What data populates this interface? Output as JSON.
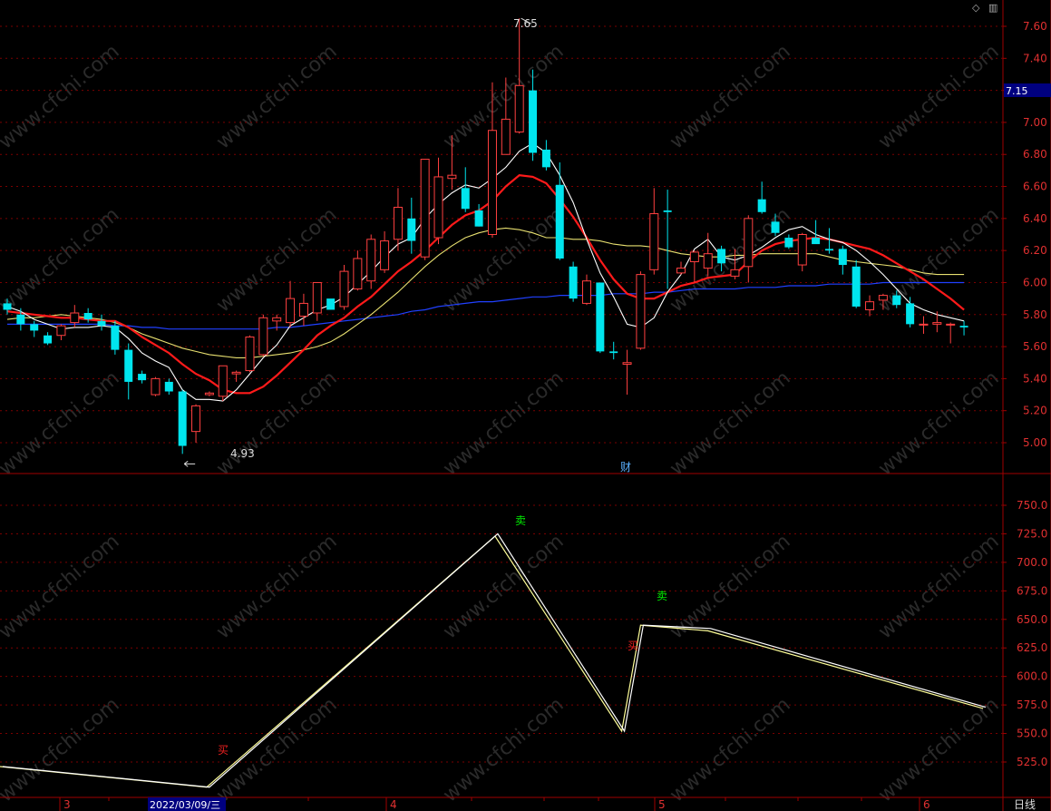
{
  "colors": {
    "up": "#ff4040",
    "down": "#00e5ee",
    "ma5": "#ffffff",
    "ma10": "#ff1a1a",
    "ma20": "#e8e070",
    "ma60": "#2040ff",
    "grid": "#7a0000",
    "axis_text": "#e03030",
    "price_badge_bg": "#000080",
    "sell_label": "#00ee00",
    "buy_label": "#ee2020",
    "event_label": "#5ab0ff",
    "watermark": "#2a2a2a"
  },
  "watermark_text": "www.cfchi.com",
  "toolbar": {
    "diamond_icon": "◇",
    "panel_icon": "▥"
  },
  "price_panel": {
    "y_ticks": [
      "7.60",
      "7.40",
      "7.20",
      "7.00",
      "6.80",
      "6.60",
      "6.40",
      "6.20",
      "6.00",
      "5.80",
      "5.60",
      "5.40",
      "5.20",
      "5.00"
    ],
    "current_price": "7.15",
    "high_annotation": "7.65",
    "low_annotation": "4.93",
    "event_marker": "财"
  },
  "indicator_panel": {
    "y_ticks": [
      "750.0",
      "725.0",
      "700.0",
      "675.0",
      "650.0",
      "625.0",
      "600.0",
      "575.0",
      "550.0",
      "525.0"
    ],
    "signals": [
      {
        "label": "卖",
        "type": "sell"
      },
      {
        "label": "卖",
        "type": "sell"
      },
      {
        "label": "买",
        "type": "buy"
      },
      {
        "label": "买",
        "type": "buy"
      }
    ]
  },
  "x_axis": {
    "month_labels": [
      "3",
      "4",
      "5",
      "6"
    ],
    "cursor_date": "2022/03/09/三",
    "period_label": "日线"
  },
  "chart_data": [
    {
      "type": "candlestick",
      "ylim": [
        4.82,
        7.72
      ],
      "ohlc": [
        [
          5.87,
          5.9,
          5.8,
          5.83
        ],
        [
          5.8,
          5.84,
          5.7,
          5.74
        ],
        [
          5.74,
          5.76,
          5.66,
          5.7
        ],
        [
          5.67,
          5.69,
          5.61,
          5.62
        ],
        [
          5.67,
          5.74,
          5.64,
          5.73
        ],
        [
          5.75,
          5.86,
          5.72,
          5.81
        ],
        [
          5.81,
          5.84,
          5.75,
          5.77
        ],
        [
          5.76,
          5.8,
          5.7,
          5.73
        ],
        [
          5.73,
          5.76,
          5.55,
          5.58
        ],
        [
          5.58,
          5.62,
          5.27,
          5.38
        ],
        [
          5.43,
          5.45,
          5.37,
          5.39
        ],
        [
          5.3,
          5.41,
          5.29,
          5.4
        ],
        [
          5.38,
          5.4,
          5.3,
          5.32
        ],
        [
          5.32,
          5.33,
          4.93,
          4.98
        ],
        [
          5.07,
          5.24,
          5.0,
          5.23
        ],
        [
          5.3,
          5.32,
          5.29,
          5.31
        ],
        [
          5.29,
          5.48,
          5.26,
          5.48
        ],
        [
          5.43,
          5.45,
          5.38,
          5.44
        ],
        [
          5.45,
          5.67,
          5.44,
          5.66
        ],
        [
          5.55,
          5.8,
          5.54,
          5.78
        ],
        [
          5.76,
          5.8,
          5.7,
          5.78
        ],
        [
          5.75,
          6.01,
          5.72,
          5.9
        ],
        [
          5.79,
          5.93,
          5.73,
          5.87
        ],
        [
          5.81,
          5.98,
          5.76,
          6.0
        ],
        [
          5.9,
          5.88,
          5.83,
          5.83
        ],
        [
          5.85,
          6.11,
          5.83,
          6.07
        ],
        [
          5.96,
          6.2,
          5.95,
          6.15
        ],
        [
          6.01,
          6.3,
          5.96,
          6.27
        ],
        [
          6.08,
          6.32,
          6.06,
          6.26
        ],
        [
          6.27,
          6.59,
          6.2,
          6.47
        ],
        [
          6.4,
          6.53,
          6.18,
          6.26
        ],
        [
          6.16,
          6.7,
          6.14,
          6.77
        ],
        [
          6.28,
          6.78,
          6.24,
          6.66
        ],
        [
          6.65,
          6.92,
          6.58,
          6.67
        ],
        [
          6.59,
          6.72,
          6.44,
          6.46
        ],
        [
          6.45,
          6.49,
          6.35,
          6.35
        ],
        [
          6.3,
          7.25,
          6.28,
          6.95
        ],
        [
          6.8,
          7.28,
          6.8,
          7.02
        ],
        [
          6.94,
          7.65,
          6.93,
          7.23
        ],
        [
          7.2,
          7.33,
          6.76,
          6.81
        ],
        [
          6.83,
          6.89,
          6.7,
          6.72
        ],
        [
          6.61,
          6.75,
          6.14,
          6.15
        ],
        [
          6.1,
          6.13,
          5.88,
          5.9
        ],
        [
          5.87,
          6.05,
          5.86,
          6.01
        ],
        [
          6.0,
          6.0,
          5.56,
          5.57
        ],
        [
          5.57,
          5.63,
          5.52,
          5.56
        ],
        [
          5.49,
          5.58,
          5.3,
          5.5
        ],
        [
          5.59,
          6.07,
          5.58,
          6.05
        ],
        [
          6.08,
          6.59,
          6.05,
          6.43
        ],
        [
          6.45,
          6.58,
          5.96,
          6.44
        ],
        [
          6.06,
          6.13,
          6.05,
          6.09
        ],
        [
          6.13,
          6.2,
          6.0,
          6.19
        ],
        [
          6.09,
          6.31,
          6.04,
          6.18
        ],
        [
          6.21,
          6.23,
          6.07,
          6.12
        ],
        [
          6.04,
          6.21,
          6.02,
          6.08
        ],
        [
          6.1,
          6.42,
          6.0,
          6.4
        ],
        [
          6.52,
          6.63,
          6.43,
          6.44
        ],
        [
          6.38,
          6.43,
          6.29,
          6.31
        ],
        [
          6.28,
          6.3,
          6.21,
          6.22
        ],
        [
          6.11,
          6.31,
          6.07,
          6.3
        ],
        [
          6.28,
          6.39,
          6.25,
          6.24
        ],
        [
          6.21,
          6.34,
          6.18,
          6.2
        ],
        [
          6.21,
          6.23,
          6.05,
          6.11
        ],
        [
          6.1,
          6.14,
          5.84,
          5.85
        ],
        [
          5.83,
          5.92,
          5.79,
          5.88
        ],
        [
          5.89,
          5.93,
          5.83,
          5.92
        ],
        [
          5.92,
          5.95,
          5.84,
          5.86
        ],
        [
          5.87,
          5.91,
          5.72,
          5.74
        ],
        [
          5.74,
          5.79,
          5.68,
          5.74
        ],
        [
          5.74,
          5.82,
          5.69,
          5.75
        ],
        [
          5.74,
          5.75,
          5.62,
          5.74
        ],
        [
          5.73,
          5.76,
          5.67,
          5.72
        ]
      ],
      "ma5": [
        5.85,
        5.82,
        5.77,
        5.74,
        5.71,
        5.72,
        5.72,
        5.73,
        5.72,
        5.65,
        5.56,
        5.51,
        5.47,
        5.33,
        5.27,
        5.27,
        5.26,
        5.33,
        5.43,
        5.53,
        5.61,
        5.73,
        5.78,
        5.83,
        5.86,
        5.91,
        5.99,
        6.07,
        6.16,
        6.24,
        6.28,
        6.4,
        6.49,
        6.56,
        6.61,
        6.59,
        6.65,
        6.72,
        6.82,
        6.87,
        6.81,
        6.67,
        6.5,
        6.27,
        6.06,
        5.91,
        5.74,
        5.72,
        5.78,
        5.94,
        6.05,
        6.21,
        6.27,
        6.16,
        6.14,
        6.17,
        6.22,
        6.28,
        6.33,
        6.35,
        6.3,
        6.27,
        6.25,
        6.2,
        6.13,
        6.05,
        5.96,
        5.87,
        5.83,
        5.8,
        5.78,
        5.76
      ],
      "ma10": [
        5.82,
        5.81,
        5.8,
        5.79,
        5.78,
        5.78,
        5.77,
        5.76,
        5.76,
        5.72,
        5.66,
        5.61,
        5.56,
        5.49,
        5.43,
        5.39,
        5.33,
        5.31,
        5.31,
        5.35,
        5.42,
        5.5,
        5.58,
        5.67,
        5.73,
        5.78,
        5.85,
        5.91,
        5.99,
        6.07,
        6.13,
        6.2,
        6.28,
        6.36,
        6.42,
        6.45,
        6.51,
        6.6,
        6.67,
        6.66,
        6.62,
        6.52,
        6.41,
        6.28,
        6.14,
        6.02,
        5.93,
        5.9,
        5.9,
        5.94,
        5.98,
        6.0,
        6.03,
        6.04,
        6.05,
        6.13,
        6.2,
        6.24,
        6.26,
        6.27,
        6.28,
        6.27,
        6.25,
        6.23,
        6.21,
        6.17,
        6.12,
        6.07,
        6.02,
        5.96,
        5.9,
        5.83
      ],
      "ma20": [
        5.77,
        5.78,
        5.78,
        5.79,
        5.8,
        5.79,
        5.78,
        5.77,
        5.75,
        5.72,
        5.68,
        5.65,
        5.62,
        5.59,
        5.57,
        5.55,
        5.54,
        5.53,
        5.53,
        5.54,
        5.55,
        5.56,
        5.58,
        5.6,
        5.63,
        5.68,
        5.74,
        5.8,
        5.87,
        5.94,
        6.02,
        6.1,
        6.17,
        6.23,
        6.28,
        6.31,
        6.33,
        6.34,
        6.33,
        6.31,
        6.28,
        6.28,
        6.27,
        6.27,
        6.26,
        6.24,
        6.23,
        6.23,
        6.22,
        6.2,
        6.18,
        6.17,
        6.16,
        6.16,
        6.17,
        6.17,
        6.18,
        6.18,
        6.18,
        6.18,
        6.18,
        6.16,
        6.14,
        6.13,
        6.12,
        6.11,
        6.1,
        6.08,
        6.06,
        6.05,
        6.05,
        6.05
      ],
      "ma60": [
        5.74,
        5.74,
        5.74,
        5.74,
        5.74,
        5.74,
        5.74,
        5.74,
        5.73,
        5.73,
        5.72,
        5.72,
        5.71,
        5.71,
        5.71,
        5.71,
        5.71,
        5.71,
        5.71,
        5.71,
        5.72,
        5.72,
        5.73,
        5.74,
        5.75,
        5.76,
        5.77,
        5.78,
        5.79,
        5.8,
        5.82,
        5.83,
        5.85,
        5.86,
        5.87,
        5.88,
        5.88,
        5.89,
        5.9,
        5.91,
        5.91,
        5.92,
        5.92,
        5.92,
        5.92,
        5.93,
        5.93,
        5.93,
        5.94,
        5.94,
        5.95,
        5.96,
        5.96,
        5.96,
        5.96,
        5.97,
        5.97,
        5.97,
        5.98,
        5.98,
        5.98,
        5.99,
        5.99,
        5.99,
        5.99,
        6.0,
        6.0,
        6.0,
        6.0,
        6.0,
        6.0,
        6.0
      ]
    },
    {
      "type": "line",
      "ylim": [
        505,
        765
      ],
      "x": [
        0,
        14.8,
        36.2,
        45.6,
        47,
        52,
        72.4
      ],
      "series": [
        {
          "values": [
            521,
            503,
            723,
            552,
            645,
            640,
            572
          ]
        },
        {
          "values": [
            521,
            503,
            725,
            552,
            645,
            642,
            573
          ]
        }
      ]
    }
  ]
}
